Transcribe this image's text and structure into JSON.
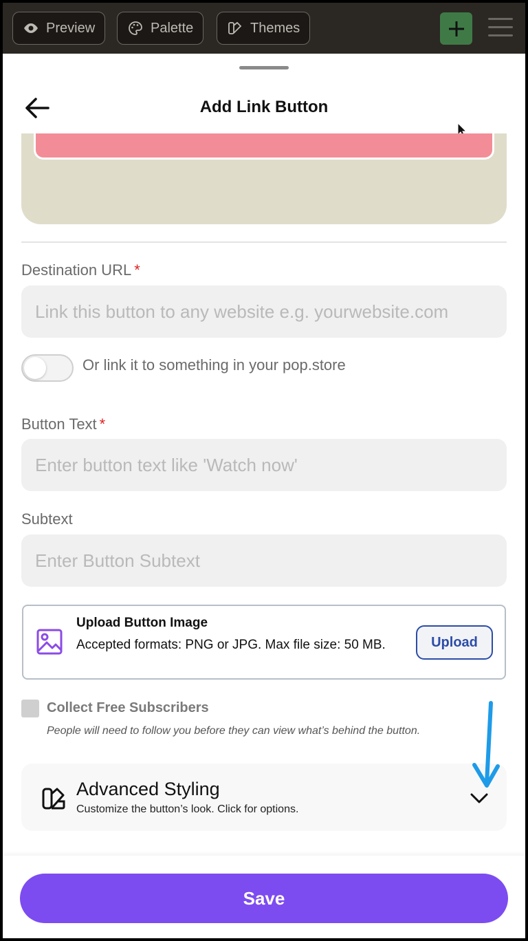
{
  "topbar": {
    "preview_label": "Preview",
    "palette_label": "Palette",
    "themes_label": "Themes"
  },
  "sheet": {
    "title": "Add Link Button"
  },
  "form": {
    "destination": {
      "label": "Destination URL",
      "required": "*",
      "placeholder": "Link this button to any website e.g. yourwebsite.com"
    },
    "toggle_label": "Or link it to something in your pop.store",
    "button_text": {
      "label": "Button Text",
      "required": "*",
      "placeholder": "Enter button text like 'Watch now'"
    },
    "subtext": {
      "label": "Subtext",
      "placeholder": "Enter Button Subtext"
    },
    "upload": {
      "title": "Upload Button Image",
      "description": "Accepted formats: PNG or JPG. Max file size: 50 MB.",
      "button_label": "Upload"
    },
    "subscribers": {
      "label": "Collect Free Subscribers",
      "note": "People will need to follow you before they can view what’s behind the button."
    },
    "advanced": {
      "title": "Advanced Styling",
      "subtitle": "Customize the button’s look. Click for options."
    }
  },
  "footer": {
    "save_label": "Save"
  },
  "colors": {
    "accent": "#7c4cf0",
    "required": "#e02020",
    "upload_border": "#2b4ca8",
    "annotation_arrow": "#1e9be8",
    "preview_pill": "#f28d98",
    "preview_bg": "#dfdcca"
  }
}
